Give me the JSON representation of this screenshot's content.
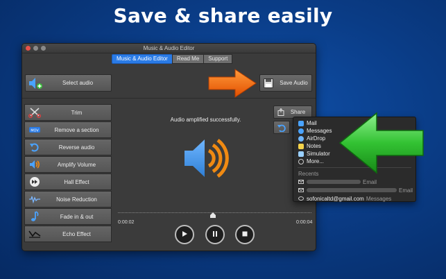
{
  "headline": "Save & share easily",
  "window": {
    "title": "Music & Audio Editor",
    "tabs": [
      {
        "label": "Music & Audio Editor",
        "active": true
      },
      {
        "label": "Read Me",
        "active": false
      },
      {
        "label": "Support",
        "active": false
      }
    ],
    "select_audio_label": "Select audio",
    "save_audio_label": "Save Audio",
    "share_label": "Share",
    "status_text": "Audio amplified successfully.",
    "time_start": "0:00:02",
    "time_end": "0:00:04"
  },
  "sidebar": {
    "items": [
      {
        "label": "Trim",
        "icon": "scissors-icon"
      },
      {
        "label": "Remove a section",
        "icon": "remove-section-icon"
      },
      {
        "label": "Reverse audio",
        "icon": "reverse-icon"
      },
      {
        "label": "Amplify Volume",
        "icon": "speaker-icon"
      },
      {
        "label": "Hall Effect",
        "icon": "hall-effect-icon"
      },
      {
        "label": "Noise Reduction",
        "icon": "noise-reduction-icon"
      },
      {
        "label": "Fade in & out",
        "icon": "music-note-icon"
      },
      {
        "label": "Echo Effect",
        "icon": "echo-icon"
      }
    ]
  },
  "share_menu": {
    "items": [
      {
        "label": "Mail",
        "icon": "mail-icon"
      },
      {
        "label": "Messages",
        "icon": "messages-icon"
      },
      {
        "label": "AirDrop",
        "icon": "airdrop-icon"
      },
      {
        "label": "Notes",
        "icon": "notes-icon"
      },
      {
        "label": "Simulator",
        "icon": "simulator-icon"
      },
      {
        "label": "More...",
        "icon": "more-icon"
      }
    ],
    "recents_header": "Recents",
    "recents": [
      {
        "name": "",
        "kind": "Email"
      },
      {
        "name": "",
        "kind": "Email"
      },
      {
        "name": "sofonicaltd@gmail.com",
        "kind": "Messages"
      }
    ]
  },
  "colors": {
    "accent_tab": "#2a7be6",
    "speaker_blue": "#3d8fe0",
    "speaker_orange": "#f08a12",
    "arrow_orange": "#ff6a00",
    "arrow_green": "#2fb52f"
  }
}
